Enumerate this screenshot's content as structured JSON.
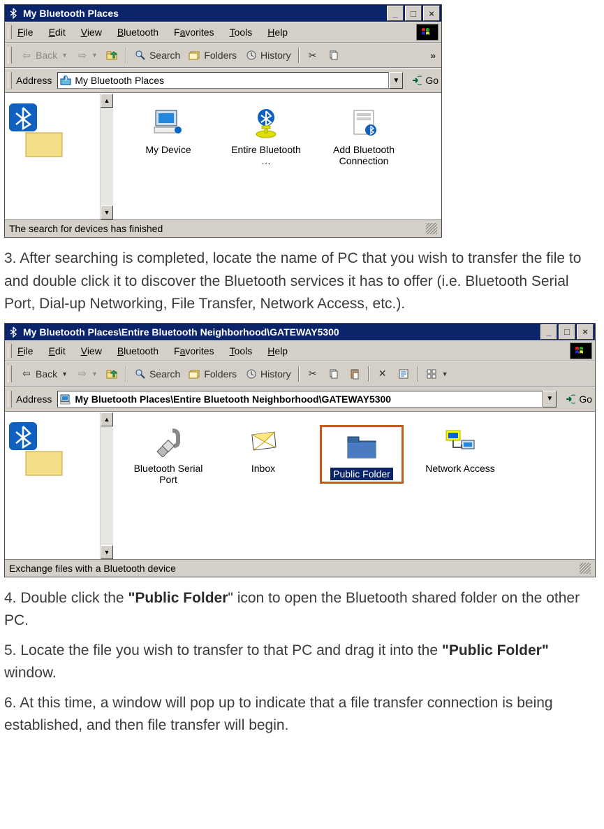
{
  "window1": {
    "title": "My Bluetooth Places",
    "menus": [
      "File",
      "Edit",
      "View",
      "Bluetooth",
      "Favorites",
      "Tools",
      "Help"
    ],
    "toolbar": {
      "back": "Back",
      "search": "Search",
      "folders": "Folders",
      "history": "History"
    },
    "address_label": "Address",
    "address_value": "My Bluetooth Places",
    "go": "Go",
    "items": [
      {
        "label": "My Device"
      },
      {
        "label": "Entire Bluetooth …"
      },
      {
        "label": "Add Bluetooth Connection"
      }
    ],
    "status": "The search for devices has finished"
  },
  "step3": "3. After searching is completed, locate the name of PC that you wish to transfer the file to and double click it to discover the Bluetooth services it has to offer (i.e. Bluetooth Serial Port, Dial-up Networking, File Transfer, Network Access, etc.).",
  "window2": {
    "title": "My Bluetooth Places\\Entire Bluetooth Neighborhood\\GATEWAY5300",
    "menus": [
      "File",
      "Edit",
      "View",
      "Bluetooth",
      "Favorites",
      "Tools",
      "Help"
    ],
    "toolbar": {
      "back": "Back",
      "search": "Search",
      "folders": "Folders",
      "history": "History"
    },
    "address_label": "Address",
    "address_value": "My Bluetooth Places\\Entire Bluetooth Neighborhood\\GATEWAY5300",
    "go": "Go",
    "items": [
      {
        "label": "Bluetooth Serial Port"
      },
      {
        "label": "Inbox"
      },
      {
        "label": "Public Folder",
        "selected": true
      },
      {
        "label": "Network Access"
      }
    ],
    "status": "Exchange files with a Bluetooth device"
  },
  "step4_pre": "4. Double click the ",
  "step4_bold": "\"Public Folder",
  "step4_post": "\" icon to open the Bluetooth shared folder on the other PC.",
  "step5_pre": "5. Locate the file you wish to transfer to that PC and drag it into the ",
  "step5_bold": "\"Public Folder\"",
  "step5_post": " window.",
  "step6": "6. At this time, a window will pop up to indicate that a file transfer connection is being established, and then file transfer will begin."
}
